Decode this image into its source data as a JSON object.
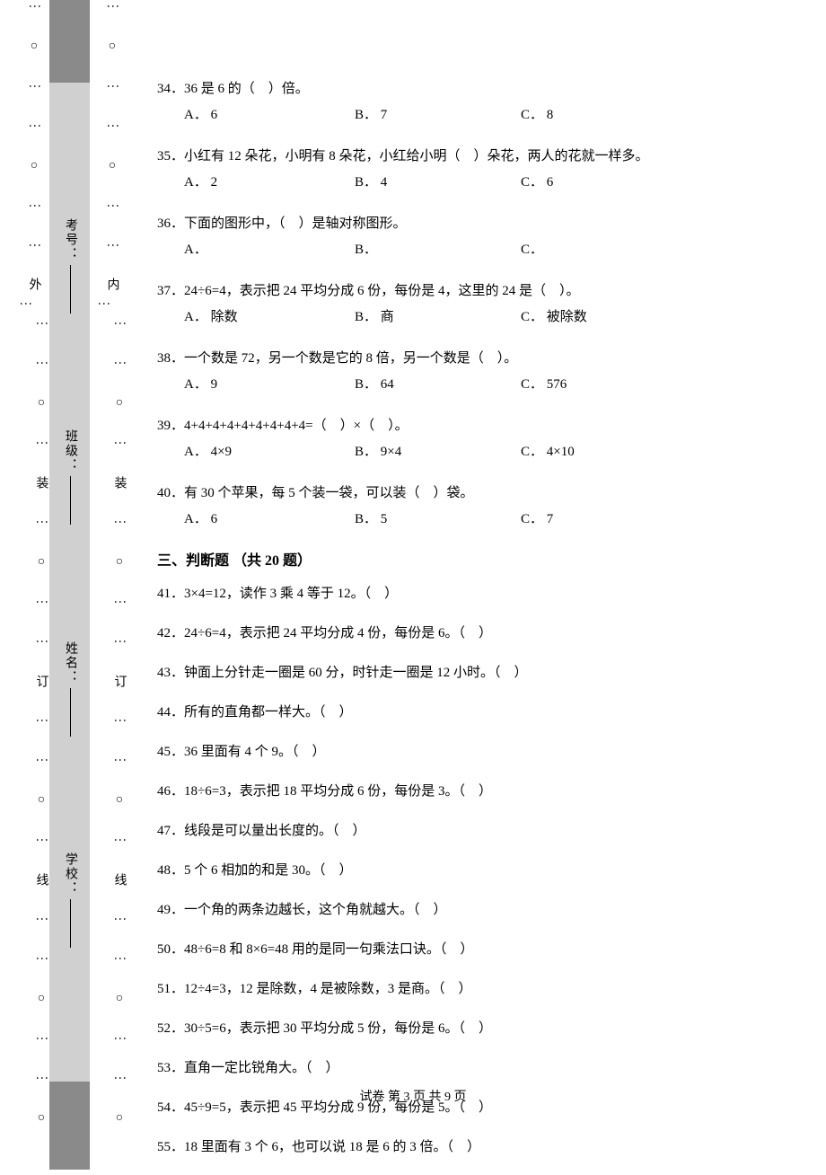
{
  "binding": {
    "outer": "外",
    "inner": "内",
    "stitch_text": "装　　　　　　　　　订　　　　　　　　　线",
    "dots_circle": "⋮　○　⋮"
  },
  "form_labels": {
    "school": "学校：",
    "name": "姓名：",
    "class": "班级：",
    "exam_no": "考号："
  },
  "questions": [
    {
      "num": "34．",
      "stem": "36 是 6 的（　）倍。",
      "opts": {
        "a": "A． 6",
        "b": "B． 7",
        "c": "C． 8"
      }
    },
    {
      "num": "35．",
      "stem": "小红有 12 朵花，小明有 8 朵花，小红给小明（　）朵花，两人的花就一样多。",
      "opts": {
        "a": "A． 2",
        "b": "B． 4",
        "c": "C． 6"
      }
    },
    {
      "num": "36．",
      "stem": "下面的图形中，（　）是轴对称图形。",
      "opts": {
        "a": "A．",
        "b": "B．",
        "c": "C．"
      }
    },
    {
      "num": "37．",
      "stem": "24÷6=4，表示把 24 平均分成 6 份，每份是 4，这里的 24 是（　）。",
      "opts": {
        "a": "A． 除数",
        "b": "B． 商",
        "c": "C． 被除数"
      }
    },
    {
      "num": "38．",
      "stem": "一个数是 72，另一个数是它的 8 倍，另一个数是（　）。",
      "opts": {
        "a": "A． 9",
        "b": "B． 64",
        "c": "C． 576"
      }
    },
    {
      "num": "39．",
      "stem": "4+4+4+4+4+4+4+4+4=（　）×（　）。",
      "opts": {
        "a": "A． 4×9",
        "b": "B． 9×4",
        "c": "C． 4×10"
      }
    },
    {
      "num": "40．",
      "stem": "有 30 个苹果，每 5 个装一袋，可以装（　）袋。",
      "opts": {
        "a": "A． 6",
        "b": "B． 5",
        "c": "C． 7"
      }
    }
  ],
  "section3_header": "三、判断题 （共 20 题）",
  "tf_questions": [
    {
      "num": "41．",
      "text": "3×4=12，读作 3 乘 4 等于 12。（　）"
    },
    {
      "num": "42．",
      "text": "24÷6=4，表示把 24 平均分成 4 份，每份是 6。（　）"
    },
    {
      "num": "43．",
      "text": "钟面上分针走一圈是 60 分，时针走一圈是 12 小时。（　）"
    },
    {
      "num": "44．",
      "text": "所有的直角都一样大。（　）"
    },
    {
      "num": "45．",
      "text": "36 里面有 4 个 9。（　）"
    },
    {
      "num": "46．",
      "text": "18÷6=3，表示把 18 平均分成 6 份，每份是 3。（　）"
    },
    {
      "num": "47．",
      "text": "线段是可以量出长度的。（　）"
    },
    {
      "num": "48．",
      "text": "5 个 6 相加的和是 30。（　）"
    },
    {
      "num": "49．",
      "text": "一个角的两条边越长，这个角就越大。（　）"
    },
    {
      "num": "50．",
      "text": "48÷6=8 和 8×6=48 用的是同一句乘法口诀。（　）"
    },
    {
      "num": "51．",
      "text": "12÷4=3，12 是除数，4 是被除数，3 是商。（　）"
    },
    {
      "num": "52．",
      "text": "30÷5=6，表示把 30 平均分成 5 份，每份是 6。（　）"
    },
    {
      "num": "53．",
      "text": "直角一定比锐角大。（　）"
    },
    {
      "num": "54．",
      "text": "45÷9=5，表示把 45 平均分成 9 份，每份是 5。（　）"
    },
    {
      "num": "55．",
      "text": "18 里面有 3 个 6，也可以说 18 是 6 的 3 倍。（　）"
    }
  ],
  "footer": "试卷 第 3 页 共 9 页"
}
